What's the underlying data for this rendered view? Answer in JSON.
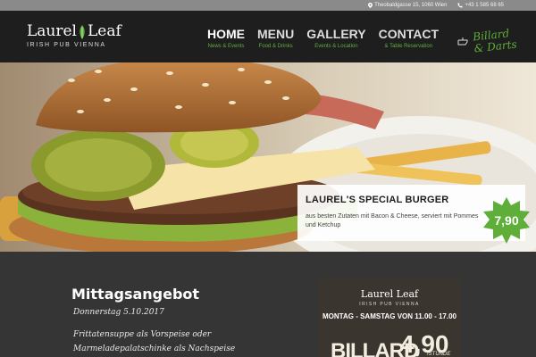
{
  "topbar": {
    "address": "Theobaldgasse 15, 1060 Wien",
    "phone": "+43 1 585 68 65"
  },
  "logo": {
    "left_word": "Laurel",
    "right_word": "Leaf",
    "sub": "IRISH PUB  VIENNA"
  },
  "nav": [
    {
      "title": "HOME",
      "sub": "News & Events"
    },
    {
      "title": "MENU",
      "sub": "Food & Drinks"
    },
    {
      "title": "GALLERY",
      "sub": "Events & Location"
    },
    {
      "title": "CONTACT",
      "sub": "& Table Reservation"
    }
  ],
  "billard": {
    "line1": "Billard",
    "line2": "& Darts"
  },
  "hero": {
    "caption_title": "LAUREL'S SPECIAL BURGER",
    "caption_text": "aus besten Zutaten mit Bacon & Cheese, serviert mit Pommes und Ketchup",
    "price": "7,90",
    "arrow": "›"
  },
  "lunch": {
    "title": "Mittagsangebot",
    "date": "Donnerstag 5.10.2017",
    "line1": "Frittatensuppe als Vorspeise oder",
    "line2": "Marmeladepalatschinke als Nachspeise"
  },
  "poster": {
    "logo": "Laurel Leaf",
    "logo_sub": "IRISH PUB  VIENNA",
    "hours": "MONTAG - SAMSTAG VON 11.00 - 17.00",
    "big": "BILLARD",
    "number": "4,90",
    "unit": "/STUNDE"
  },
  "colors": {
    "accent_green": "#5fae3a",
    "header_bg": "#1e1e1e",
    "topbar_bg": "#8a8a8a",
    "section_bg": "#353535"
  }
}
